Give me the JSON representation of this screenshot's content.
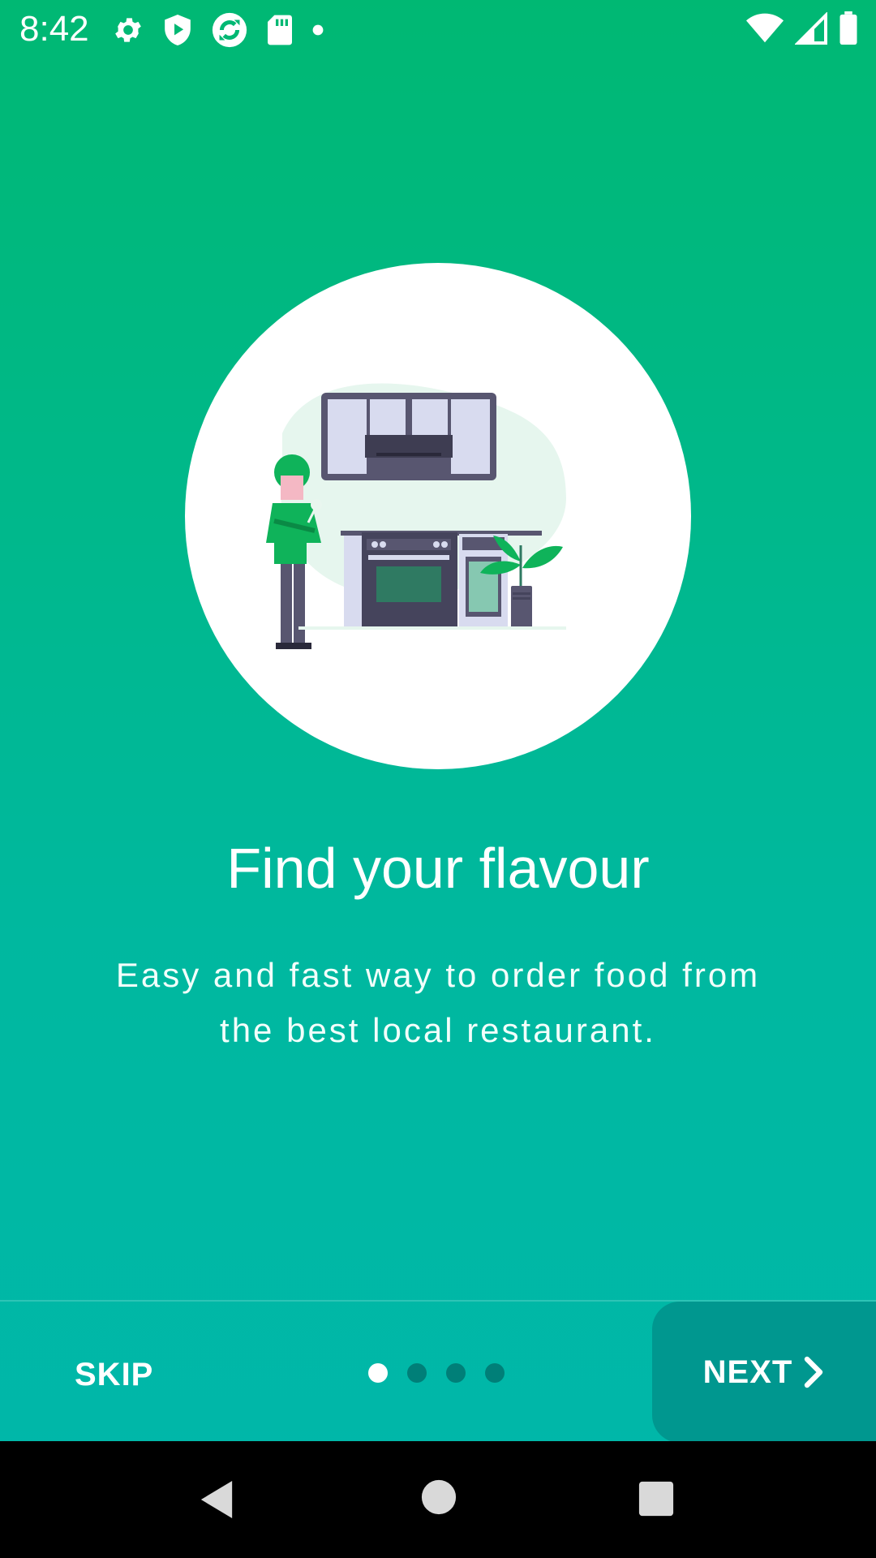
{
  "status_bar": {
    "time": "8:42",
    "left_icons": [
      "settings-icon",
      "shield-play-icon",
      "sync-icon",
      "sd-card-icon",
      "dot-icon"
    ],
    "right_icons": [
      "wifi-icon",
      "cell-signal-icon",
      "battery-icon"
    ]
  },
  "onboarding": {
    "title": "Find your flavour",
    "subtitle": "Easy and fast way to order food from the best local restaurant."
  },
  "bottom_bar": {
    "skip_label": "SKIP",
    "next_label": "NEXT",
    "page_count": 4,
    "current_page": 1
  },
  "colors": {
    "gradient_top": "#00b873",
    "gradient_bottom": "#00b7ab",
    "next_bg": "#00978f",
    "dot_inactive": "#007f78",
    "dot_active": "#ffffff"
  },
  "nav_bar": {
    "icons": [
      "back-icon",
      "home-icon",
      "recents-icon"
    ]
  }
}
